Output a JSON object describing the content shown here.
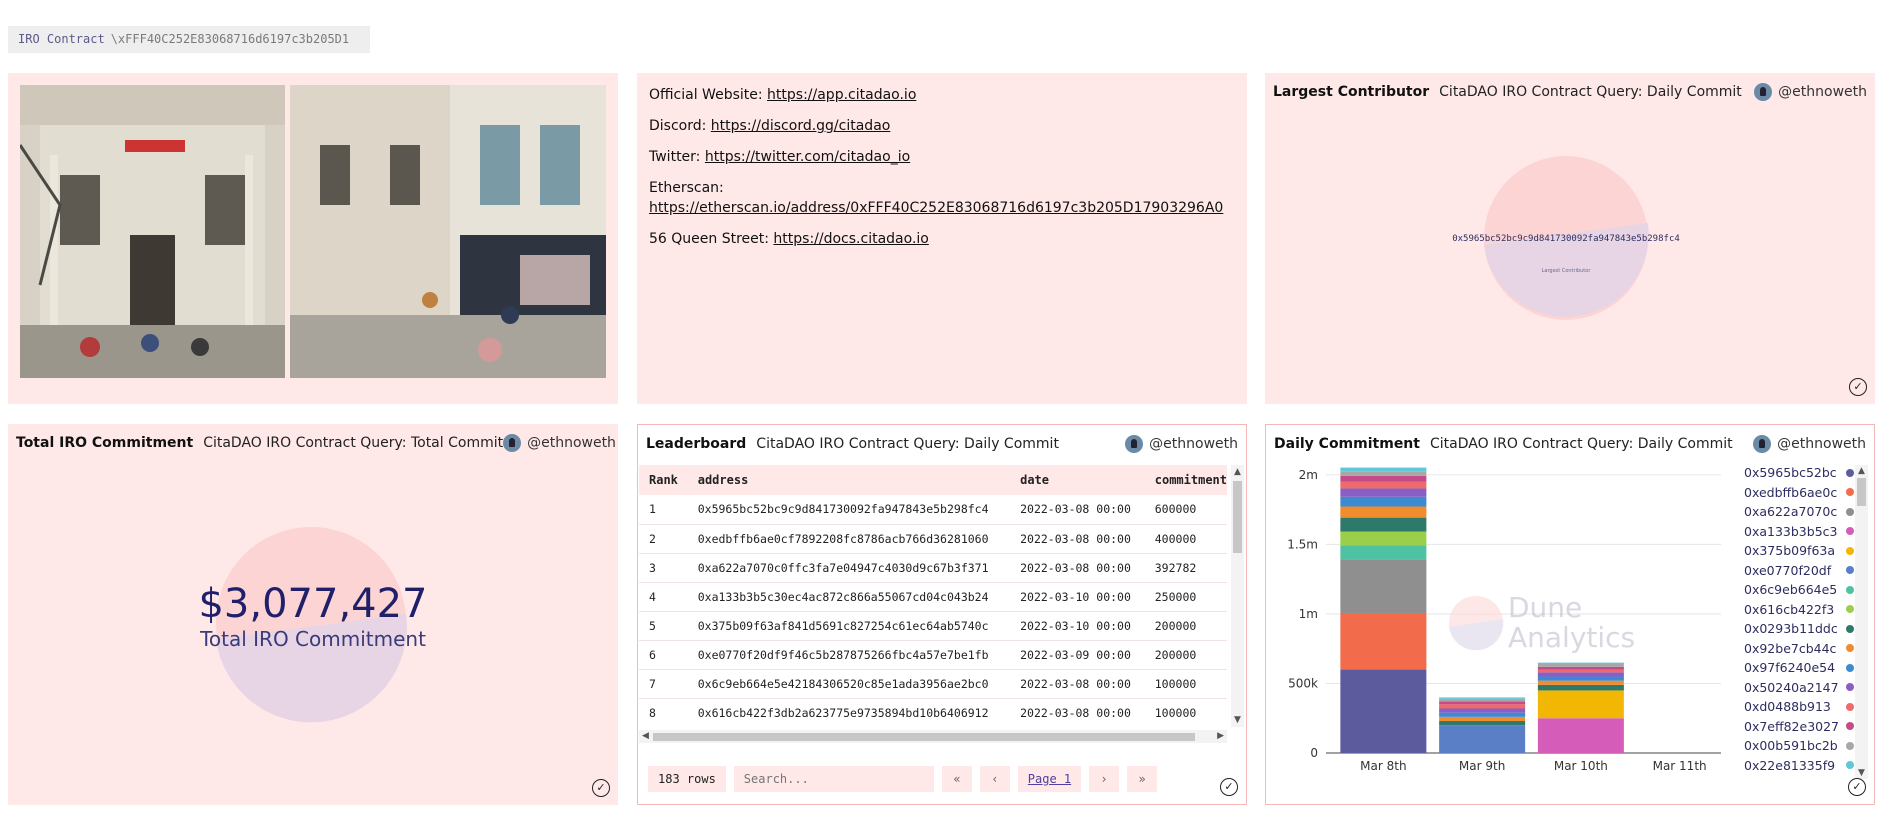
{
  "contract": {
    "label": "IRO Contract",
    "value": "\\xFFF40C252E83068716d6197c3b205D1"
  },
  "links": [
    {
      "label": "Official Website:",
      "url": "https://app.citadao.io"
    },
    {
      "label": "Discord:",
      "url": "https://discord.gg/citadao"
    },
    {
      "label": "Twitter:",
      "url": "https://twitter.com/citadao_io"
    },
    {
      "label": "Etherscan:",
      "url": "https://etherscan.io/address/0xFFF40C252E83068716d6197c3b205D17903296A0"
    },
    {
      "label": "56 Queen Street:",
      "url": "https://docs.citadao.io"
    }
  ],
  "largest": {
    "title": "Largest Contributor",
    "query": "CitaDAO IRO Contract Query: Daily Commit",
    "user": "@ethnoweth",
    "counter_value": "0x5965bc52bc9c9d841730092fa947843e5b298fc4",
    "counter_label": "Largest Contributor"
  },
  "total": {
    "title": "Total IRO Commitment",
    "query": "CitaDAO IRO Contract Query: Total Commit",
    "user": "@ethnoweth",
    "value": "$3,077,427",
    "label": "Total IRO Commitment"
  },
  "leaderboard": {
    "title": "Leaderboard",
    "query": "CitaDAO IRO Contract Query: Daily Commit",
    "user": "@ethnoweth",
    "columns": [
      "Rank",
      "address",
      "date",
      "commitment"
    ],
    "rows": [
      [
        "1",
        "0x5965bc52bc9c9d841730092fa947843e5b298fc4",
        "2022-03-08 00:00",
        "600000"
      ],
      [
        "2",
        "0xedbffb6ae0cf7892208fc8786acb766d36281060",
        "2022-03-08 00:00",
        "400000"
      ],
      [
        "3",
        "0xa622a7070c0ffc3fa7e04947c4030d9c67b3f371",
        "2022-03-08 00:00",
        "392782"
      ],
      [
        "4",
        "0xa133b3b5c30ec4ac872c866a55067cd04c043b24",
        "2022-03-10 00:00",
        "250000"
      ],
      [
        "5",
        "0x375b09f63af841d5691c827254c61ec64ab5740c",
        "2022-03-10 00:00",
        "200000"
      ],
      [
        "6",
        "0xe0770f20df9f46c5b287875266fbc4a57e7be1fb",
        "2022-03-09 00:00",
        "200000"
      ],
      [
        "7",
        "0x6c9eb664e5e42184306520c85e1ada3956ae2bc0",
        "2022-03-08 00:00",
        "100000"
      ],
      [
        "8",
        "0x616cb422f3db2a623775e9735894bd10b6406912",
        "2022-03-08 00:00",
        "100000"
      ]
    ],
    "row_count": "183 rows",
    "search_placeholder": "Search...",
    "page": "Page 1",
    "nav": {
      "first": "«",
      "prev": "‹",
      "next": "›",
      "last": "»"
    }
  },
  "daily": {
    "title": "Daily Commitment",
    "query": "CitaDAO IRO Contract Query: Daily Commit",
    "user": "@ethnoweth",
    "watermark_line1": "Dune",
    "watermark_line2": "Analytics",
    "legend": [
      {
        "name": "0x5965bc52bc",
        "color": "#5b5b9e"
      },
      {
        "name": "0xedbffb6ae0c",
        "color": "#f26b4b"
      },
      {
        "name": "0xa622a7070c",
        "color": "#8f8f8f"
      },
      {
        "name": "0xa133b3b5c3",
        "color": "#d55cb8"
      },
      {
        "name": "0x375b09f63a",
        "color": "#f2b705"
      },
      {
        "name": "0xe0770f20df",
        "color": "#5b7fc6"
      },
      {
        "name": "0x6c9eb664e5",
        "color": "#4fc2a3"
      },
      {
        "name": "0x616cb422f3",
        "color": "#9bcf4a"
      },
      {
        "name": "0x0293b11ddc",
        "color": "#2d7a6a"
      },
      {
        "name": "0x92be7cb44c",
        "color": "#f08c2e"
      },
      {
        "name": "0x97f6240e54",
        "color": "#3c8ad1"
      },
      {
        "name": "0x50240a2147",
        "color": "#8a5ec2"
      },
      {
        "name": "0xd0488b913",
        "color": "#ef6a6a"
      },
      {
        "name": "0x7eff82e3027",
        "color": "#c54a8a"
      },
      {
        "name": "0x00b591bc2b",
        "color": "#a7a7a7"
      },
      {
        "name": "0x22e81335f9",
        "color": "#5fc8d6"
      }
    ]
  },
  "chart_data": {
    "type": "bar",
    "categories": [
      "Mar 8th",
      "Mar 9th",
      "Mar 10th",
      "Mar 11th"
    ],
    "yticks": [
      "0",
      "500k",
      "1m",
      "1.5m",
      "2m"
    ],
    "ylim": [
      0,
      2100000
    ],
    "stacked": true,
    "series": [
      {
        "name": "0x5965bc52bc",
        "values": [
          600000,
          0,
          0,
          0
        ]
      },
      {
        "name": "0xedbffb6ae0c",
        "values": [
          400000,
          0,
          0,
          0
        ]
      },
      {
        "name": "0xa622a7070c",
        "values": [
          392782,
          0,
          0,
          0
        ]
      },
      {
        "name": "0xa133b3b5c3",
        "values": [
          0,
          0,
          250000,
          0
        ]
      },
      {
        "name": "0x375b09f63a",
        "values": [
          0,
          0,
          200000,
          0
        ]
      },
      {
        "name": "0xe0770f20df",
        "values": [
          0,
          200000,
          0,
          0
        ]
      },
      {
        "name": "0x6c9eb664e5",
        "values": [
          100000,
          0,
          0,
          0
        ]
      },
      {
        "name": "0x616cb422f3",
        "values": [
          100000,
          0,
          0,
          0
        ]
      },
      {
        "name": "0x0293b11ddc",
        "values": [
          100000,
          30000,
          40000,
          0
        ]
      },
      {
        "name": "0x92be7cb44c",
        "values": [
          80000,
          30000,
          30000,
          0
        ]
      },
      {
        "name": "0x97f6240e54",
        "values": [
          70000,
          30000,
          30000,
          0
        ]
      },
      {
        "name": "0x50240a2147",
        "values": [
          60000,
          30000,
          30000,
          0
        ]
      },
      {
        "name": "0xd0488b913",
        "values": [
          50000,
          30000,
          20000,
          0
        ]
      },
      {
        "name": "0x7eff82e3027",
        "values": [
          40000,
          20000,
          20000,
          0
        ]
      },
      {
        "name": "0x00b591bc2b",
        "values": [
          30000,
          20000,
          20000,
          0
        ]
      },
      {
        "name": "0x22e81335f9",
        "values": [
          30000,
          10000,
          10000,
          0
        ]
      }
    ]
  }
}
